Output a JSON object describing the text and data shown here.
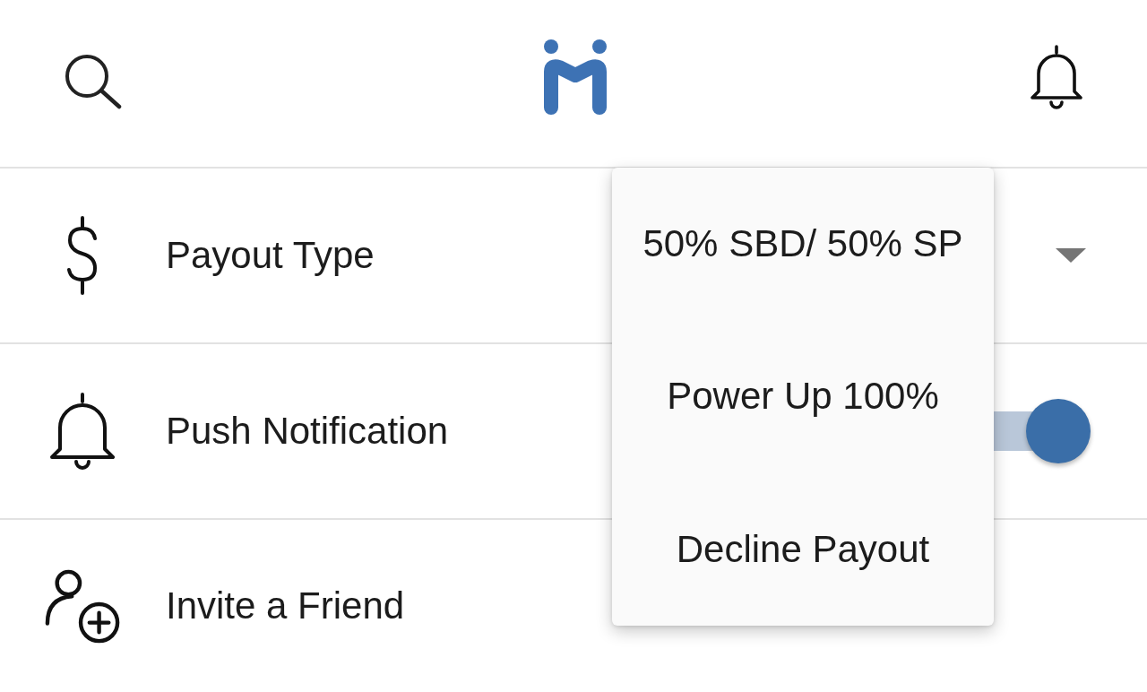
{
  "settings": [
    {
      "kind": "dropdown",
      "label": "Payout Type",
      "expanded": true,
      "options": [
        {
          "label": "50% SBD/ 50% SP",
          "selected": false
        },
        {
          "label": "Power Up 100%",
          "selected": false
        },
        {
          "label": "Decline Payout",
          "selected": false
        }
      ]
    },
    {
      "kind": "toggle",
      "label": "Push Notification",
      "on": true
    },
    {
      "kind": "link",
      "label": "Invite a Friend"
    }
  ]
}
